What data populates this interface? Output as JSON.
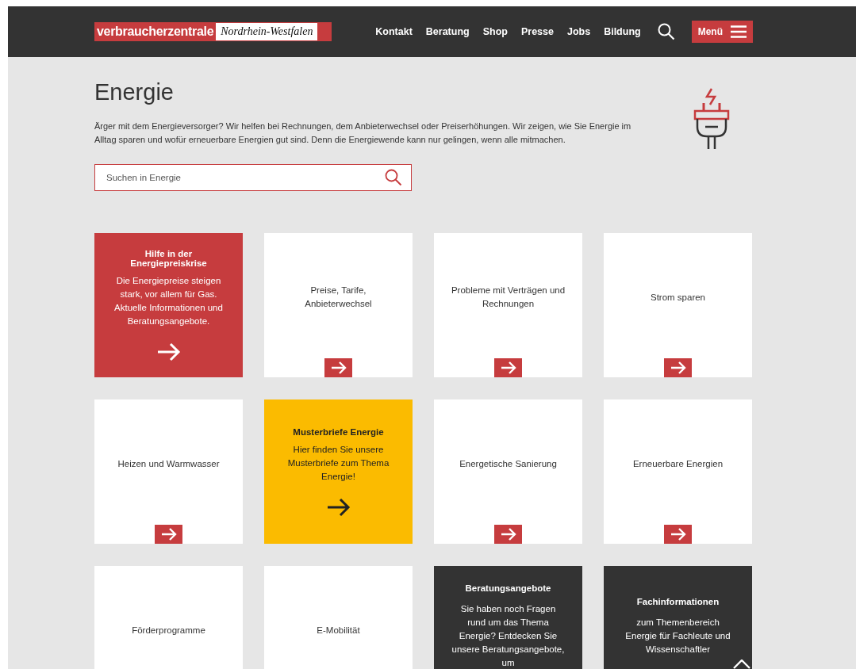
{
  "header": {
    "logo": {
      "brand": "verbraucherzentrale",
      "region": "Nordrhein-Westfalen"
    },
    "nav": [
      "Kontakt",
      "Beratung",
      "Shop",
      "Presse",
      "Jobs",
      "Bildung"
    ],
    "menu_button": "Menü"
  },
  "page": {
    "title": "Energie",
    "intro": "Ärger mit dem Energieversorger? Wir helfen bei Rechnungen, dem Anbieterwechsel oder Preiserhöhungen. Wir zeigen, wie Sie Energie im Alltag sparen und wofür erneuerbare Energien gut sind. Denn die Energiewende kann nur gelingen, wenn alle mitmachen.",
    "search": {
      "placeholder": "Suchen in Energie"
    }
  },
  "tiles": [
    {
      "kind": "feature",
      "color": "#c63c3e",
      "title": "Hilfe in der Energiepreiskrise",
      "text": "Die Energiepreise steigen stark, vor allem für Gas. Aktuelle Informationen und Beratungsangebote.",
      "arrow": true
    },
    {
      "kind": "link",
      "label": "Preise, Tarife, Anbieterwechsel"
    },
    {
      "kind": "link",
      "label": "Probleme mit Verträgen und Rechnungen"
    },
    {
      "kind": "link",
      "label": "Strom sparen"
    },
    {
      "kind": "link",
      "label": "Heizen und Warmwasser"
    },
    {
      "kind": "feature",
      "color": "#fbbb00",
      "title": "Musterbriefe Energie",
      "text": "Hier finden Sie unsere Musterbriefe zum Thema Energie!",
      "arrow": true
    },
    {
      "kind": "link",
      "label": "Energetische Sanierung"
    },
    {
      "kind": "link",
      "label": "Erneuerbare Energien"
    },
    {
      "kind": "link",
      "label": "Förderprogramme"
    },
    {
      "kind": "link",
      "label": "E-Mobilität"
    },
    {
      "kind": "feature",
      "color": "#333333",
      "title": "Beratungsangebote",
      "text": "Sie haben noch Fragen rund um das Thema Energie? Entdecken Sie unsere Beratungsangebote, um",
      "arrow": false
    },
    {
      "kind": "feature",
      "color": "#333333",
      "title": "Fachinformationen",
      "text": "zum Themenbereich Energie für Fachleute und Wissenschaftler",
      "arrow": false
    }
  ]
}
